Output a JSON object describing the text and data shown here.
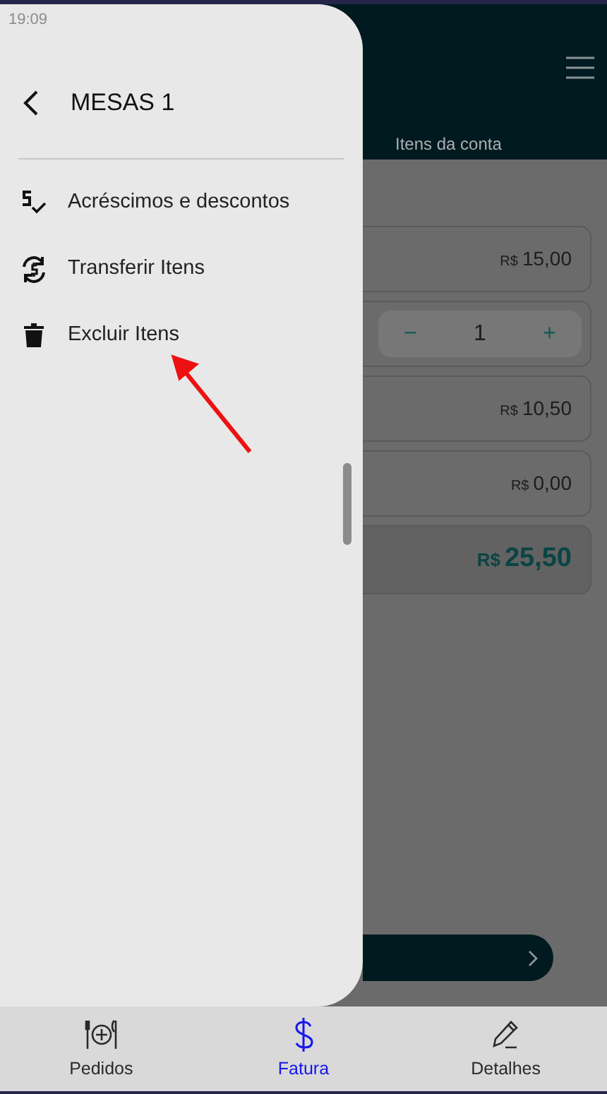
{
  "status_bar": {
    "time": "19:09"
  },
  "header": {
    "tab_label": "Itens da conta"
  },
  "bill_lines": [
    {
      "kind": "price",
      "currency": "R$",
      "amount": "15,00"
    },
    {
      "kind": "quantity",
      "minus": "−",
      "quantity": "1",
      "plus": "+"
    },
    {
      "kind": "price",
      "currency": "R$",
      "amount": "10,50"
    },
    {
      "kind": "price",
      "currency": "R$",
      "amount": "0,00"
    },
    {
      "kind": "total",
      "currency": "R$",
      "amount": "25,50"
    }
  ],
  "drawer": {
    "title": "MESAS 1",
    "items": [
      {
        "label": "Acréscimos e descontos"
      },
      {
        "label": "Transferir Itens"
      },
      {
        "label": "Excluir Itens"
      }
    ]
  },
  "bottom_nav": [
    {
      "label": "Pedidos",
      "selected": false
    },
    {
      "label": "Fatura",
      "selected": true
    },
    {
      "label": "Detalhes",
      "selected": false
    }
  ]
}
